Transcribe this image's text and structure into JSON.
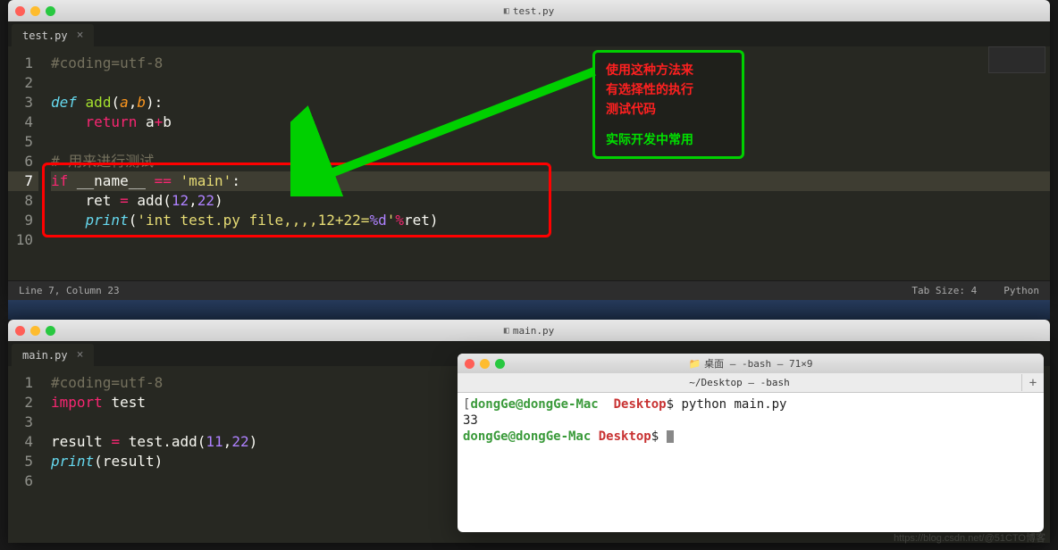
{
  "window1": {
    "title": "test.py",
    "tab": {
      "name": "test.py",
      "close": "×"
    },
    "lines": [
      {
        "n": "1",
        "html": "<span class='c-comment'>#coding=utf-8</span>"
      },
      {
        "n": "2",
        "html": ""
      },
      {
        "n": "3",
        "html": "<span class='c-kw2'>def</span> <span class='c-func'>add</span><span class='c-txt'>(</span><span class='c-param'>a</span><span class='c-txt'>,</span><span class='c-param'>b</span><span class='c-txt'>):</span>"
      },
      {
        "n": "4",
        "html": "    <span class='c-kw'>return</span> <span class='c-txt'>a</span><span class='c-op'>+</span><span class='c-txt'>b</span>"
      },
      {
        "n": "5",
        "html": ""
      },
      {
        "n": "6",
        "html": "<span class='c-comment'># 用来进行测试</span>"
      },
      {
        "n": "7",
        "html": "<span class='c-kw'>if</span> <span class='c-txt'>__name__ </span><span class='c-op'>==</span><span class='c-txt'> </span><span class='c-str'>'main'</span><span class='c-txt'>:</span>",
        "active": true
      },
      {
        "n": "8",
        "html": "    <span class='c-txt'>ret </span><span class='c-op'>=</span><span class='c-txt'> add(</span><span class='c-num'>12</span><span class='c-txt'>,</span><span class='c-num'>22</span><span class='c-txt'>)</span>"
      },
      {
        "n": "9",
        "html": "    <span class='c-kw2'>print</span><span class='c-txt'>(</span><span class='c-str'>'int test.py file,,,,12+22=</span><span class='c-num'>%d</span><span class='c-str'>'</span><span class='c-op'>%</span><span class='c-txt'>ret)</span>"
      },
      {
        "n": "10",
        "html": ""
      }
    ],
    "status": {
      "left": "Line 7, Column 23",
      "tab_size": "Tab Size: 4",
      "lang": "Python"
    }
  },
  "window2": {
    "title": "main.py",
    "tab": {
      "name": "main.py",
      "close": "×"
    },
    "lines": [
      {
        "n": "1",
        "html": "<span class='c-comment'>#coding=utf-8</span>"
      },
      {
        "n": "2",
        "html": "<span class='c-kw'>import</span> <span class='c-txt'>test</span>"
      },
      {
        "n": "3",
        "html": ""
      },
      {
        "n": "4",
        "html": "<span class='c-txt'>result </span><span class='c-op'>=</span><span class='c-txt'> test.add(</span><span class='c-num'>11</span><span class='c-txt'>,</span><span class='c-num'>22</span><span class='c-txt'>)</span>"
      },
      {
        "n": "5",
        "html": "<span class='c-kw2'>print</span><span class='c-txt'>(result)</span>"
      },
      {
        "n": "6",
        "html": ""
      }
    ]
  },
  "terminal": {
    "folder_icon": "📁",
    "title": "桌面 — -bash — 71×9",
    "tab": "~/Desktop — -bash",
    "plus": "+",
    "lines": [
      {
        "html": "<span class='t-brk'>[</span><span class='t-user'>dongGe@dongGe-Mac</span> <span class='c-txt' style='color:#222'> </span><span class='t-host'>Desktop</span><span class='t-cmd'>$ python main.py</span>"
      },
      {
        "html": "<span class='t-cmd'>33</span>"
      },
      {
        "html": "<span class='t-user'>dongGe@dongGe-Mac</span> <span class='t-host'>Desktop</span><span class='t-cmd'>$ </span><span class='t-cursor'></span>"
      }
    ]
  },
  "callout": {
    "l1": "使用这种方法来",
    "l2": "有选择性的执行",
    "l3": "测试代码",
    "l4": "实际开发中常用"
  },
  "watermark": "https://blog.csdn.net/@51CTO博客"
}
